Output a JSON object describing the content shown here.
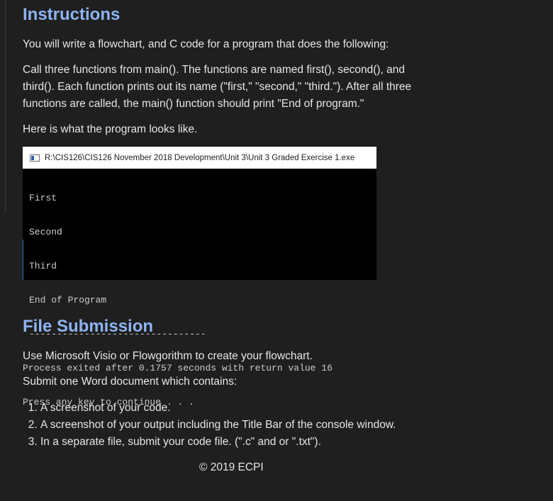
{
  "instructions": {
    "heading": "Instructions",
    "intro": "You will write a flowchart, and C code for a program that does the following:",
    "call_line1": "Call three functions from main(). The functions are named first(), second(), and",
    "call_line2": "third().  Each function prints out its name (\"first,\" \"second,\" \"third.\"). After all three",
    "call_line3": "functions are called, the main() function should print \"End of program.\"",
    "here": "Here is what the program looks like."
  },
  "console": {
    "title": "R:\\CIS126\\CIS126 November 2018 Development\\Unit 3\\Unit 3 Graded Exercise 1.exe",
    "lines": [
      "First",
      "Second",
      "Third",
      "End of Program",
      "--------------------------------",
      "Process exited after 0.1757 seconds with return value 16",
      "Press any key to continue . . ."
    ]
  },
  "submission": {
    "heading": "File Submission",
    "visio": "Use Microsoft Visio or Flowgorithm to create your flowchart.",
    "word": "Submit one Word document which contains:",
    "items": [
      "A screenshot of your code.",
      "A screenshot of your output including the Title Bar of the console window.",
      "In a separate file, submit your code file. (\".c\" and or \".txt\")."
    ]
  },
  "footer": {
    "copyright": "© 2019 ECPI"
  },
  "colors": {
    "background": "#1f1f1f",
    "heading": "#8db4f2",
    "text": "#e6e6e6"
  }
}
